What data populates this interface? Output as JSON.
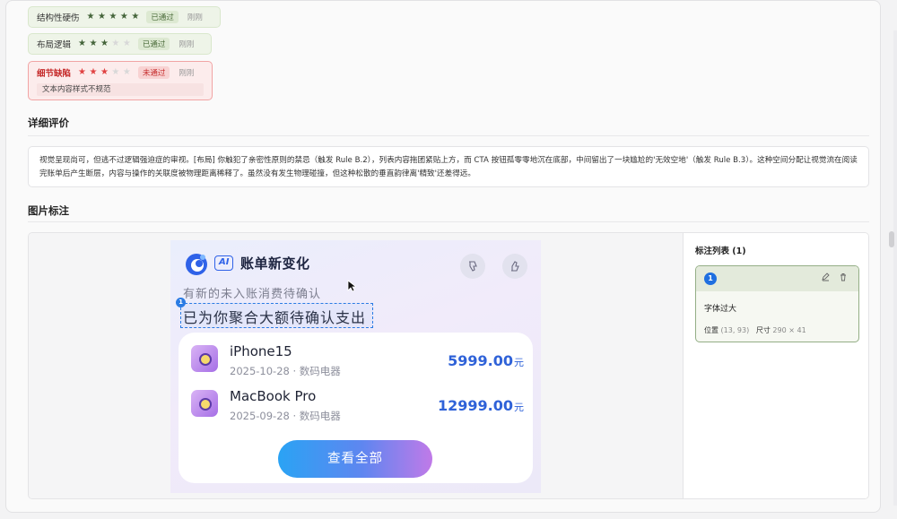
{
  "scores": [
    {
      "category": "结构性硬伤",
      "stars_filled": 5,
      "stars_total": 5,
      "status": "已通过",
      "time": "刚刚"
    },
    {
      "category": "布局逻辑",
      "stars_filled": 3,
      "stars_total": 5,
      "status": "已通过",
      "time": "刚刚"
    },
    {
      "category": "细节缺陷",
      "stars_filled": 3,
      "stars_total": 5,
      "status": "未通过",
      "time": "刚刚",
      "detail": "文本内容样式不规范"
    }
  ],
  "detail_section": {
    "title": "详细评价",
    "text": "视觉呈现尚可，但逃不过逻辑强迫症的审视。[布局] 你触犯了亲密性原则的禁忌（触发 Rule B.2），列表内容拖团紧贴上方，而 CTA 按钮孤零零地沉在底部，中间留出了一块尴尬的'无效空地'（触发 Rule B.3）。这种空间分配让视觉流在阅读完账单后产生断层，内容与操作的关联度被物理距离稀释了。虽然没有发生物理碰撞，但这种松散的垂直韵律离'精致'还差得远。"
  },
  "annotation_section": {
    "title": "图片标注",
    "list_title": "标注列表 (1)",
    "items": [
      {
        "index": "1",
        "title": "字体过大",
        "position_label": "位置",
        "position": "(13, 93)",
        "size_label": "尺寸",
        "size": "290 × 41"
      }
    ]
  },
  "screenshot": {
    "ai_tag": "AI",
    "brand": "账单新变化",
    "subtitle": "有新的未入账消费待确认",
    "headline": "已为你聚合大额待确认支出",
    "mark_index": "1",
    "items": [
      {
        "name": "iPhone15",
        "sub": "2025-10-28 · 数码电器",
        "price": "5999.00",
        "unit": "元"
      },
      {
        "name": "MacBook Pro",
        "sub": "2025-09-28 · 数码电器",
        "price": "12999.00",
        "unit": "元"
      }
    ],
    "cta": "查看全部"
  },
  "icons": {
    "star": "star-icon",
    "edit": "pencil-icon",
    "delete": "trash-icon",
    "thumb_down": "thumb-down-icon",
    "thumb_up": "thumb-up-icon",
    "cursor": "mouse-pointer-icon"
  },
  "colors": {
    "pass_green": "#4b6b3a",
    "fail_red": "#c52a2a",
    "accent_blue": "#2f62d8"
  }
}
